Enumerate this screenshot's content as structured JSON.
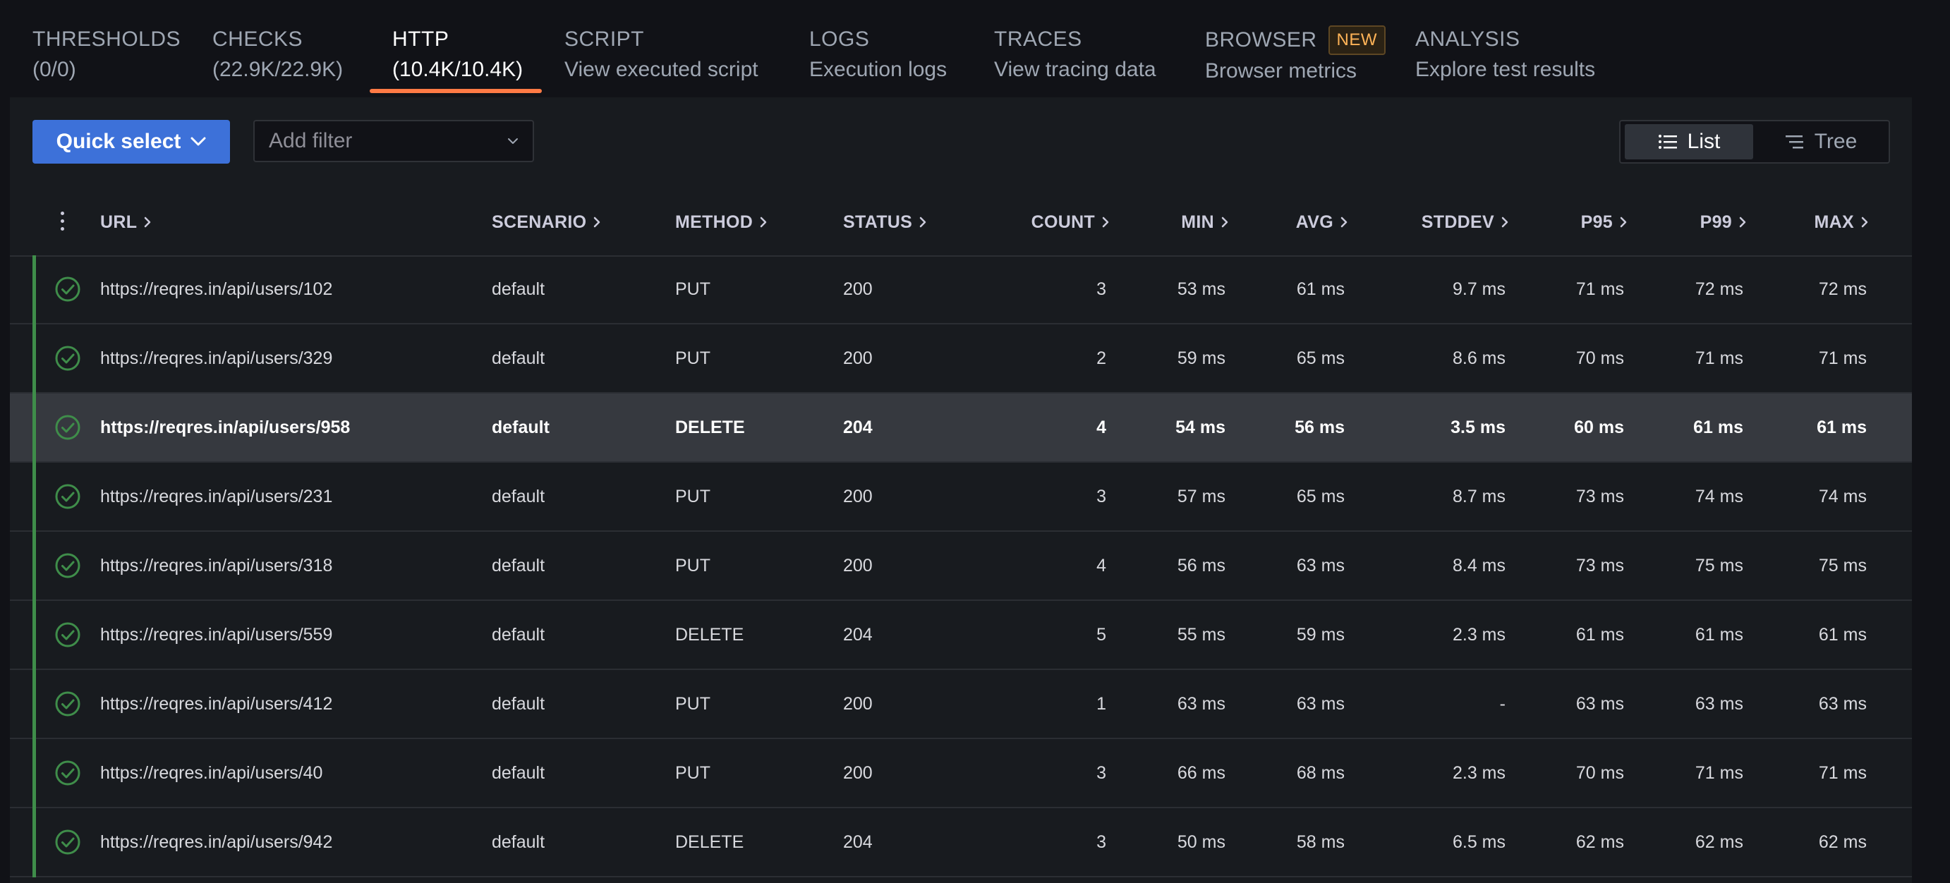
{
  "tabs": [
    {
      "title": "THRESHOLDS",
      "subtitle": "(0/0)"
    },
    {
      "title": "CHECKS",
      "subtitle": "(22.9K/22.9K)"
    },
    {
      "title": "HTTP",
      "subtitle": "(10.4K/10.4K)",
      "active": true
    },
    {
      "title": "SCRIPT",
      "subtitle": "View executed script"
    },
    {
      "title": "LOGS",
      "subtitle": "Execution logs"
    },
    {
      "title": "TRACES",
      "subtitle": "View tracing data"
    },
    {
      "title": "BROWSER",
      "subtitle": "Browser metrics",
      "badge": "NEW"
    },
    {
      "title": "ANALYSIS",
      "subtitle": "Explore test results"
    }
  ],
  "toolbar": {
    "quick_select_label": "Quick select",
    "filter_placeholder": "Add filter",
    "view_list_label": "List",
    "view_tree_label": "Tree"
  },
  "table": {
    "headers": [
      "URL",
      "SCENARIO",
      "METHOD",
      "STATUS",
      "COUNT",
      "MIN",
      "AVG",
      "STDDEV",
      "P95",
      "P99",
      "MAX"
    ],
    "rows": [
      {
        "url": "https://reqres.in/api/users/102",
        "scenario": "default",
        "method": "PUT",
        "status": "200",
        "count": "3",
        "min": "53 ms",
        "avg": "61 ms",
        "stddev": "9.7 ms",
        "p95": "71 ms",
        "p99": "72 ms",
        "max": "72 ms"
      },
      {
        "url": "https://reqres.in/api/users/329",
        "scenario": "default",
        "method": "PUT",
        "status": "200",
        "count": "2",
        "min": "59 ms",
        "avg": "65 ms",
        "stddev": "8.6 ms",
        "p95": "70 ms",
        "p99": "71 ms",
        "max": "71 ms"
      },
      {
        "url": "https://reqres.in/api/users/958",
        "scenario": "default",
        "method": "DELETE",
        "status": "204",
        "count": "4",
        "min": "54 ms",
        "avg": "56 ms",
        "stddev": "3.5 ms",
        "p95": "60 ms",
        "p99": "61 ms",
        "max": "61 ms",
        "highlighted": true
      },
      {
        "url": "https://reqres.in/api/users/231",
        "scenario": "default",
        "method": "PUT",
        "status": "200",
        "count": "3",
        "min": "57 ms",
        "avg": "65 ms",
        "stddev": "8.7 ms",
        "p95": "73 ms",
        "p99": "74 ms",
        "max": "74 ms"
      },
      {
        "url": "https://reqres.in/api/users/318",
        "scenario": "default",
        "method": "PUT",
        "status": "200",
        "count": "4",
        "min": "56 ms",
        "avg": "63 ms",
        "stddev": "8.4 ms",
        "p95": "73 ms",
        "p99": "75 ms",
        "max": "75 ms"
      },
      {
        "url": "https://reqres.in/api/users/559",
        "scenario": "default",
        "method": "DELETE",
        "status": "204",
        "count": "5",
        "min": "55 ms",
        "avg": "59 ms",
        "stddev": "2.3 ms",
        "p95": "61 ms",
        "p99": "61 ms",
        "max": "61 ms"
      },
      {
        "url": "https://reqres.in/api/users/412",
        "scenario": "default",
        "method": "PUT",
        "status": "200",
        "count": "1",
        "min": "63 ms",
        "avg": "63 ms",
        "stddev": "-",
        "p95": "63 ms",
        "p99": "63 ms",
        "max": "63 ms"
      },
      {
        "url": "https://reqres.in/api/users/40",
        "scenario": "default",
        "method": "PUT",
        "status": "200",
        "count": "3",
        "min": "66 ms",
        "avg": "68 ms",
        "stddev": "2.3 ms",
        "p95": "70 ms",
        "p99": "71 ms",
        "max": "71 ms"
      },
      {
        "url": "https://reqres.in/api/users/942",
        "scenario": "default",
        "method": "DELETE",
        "status": "204",
        "count": "3",
        "min": "50 ms",
        "avg": "58 ms",
        "stddev": "6.5 ms",
        "p95": "62 ms",
        "p99": "62 ms",
        "max": "62 ms"
      }
    ]
  },
  "colors": {
    "accent_tab": "#ff7a45",
    "primary_button": "#3d71d9",
    "status_ok": "#3f8d4a",
    "badge_new": "#ffb357"
  },
  "icons": {
    "quick_select": "chevron-down-icon",
    "filter": "chevron-down-icon",
    "list": "list-icon",
    "tree": "tree-icon",
    "row_status": "check-circle-icon",
    "sort": "chevron-right-icon",
    "column_menu": "kebab-menu-icon"
  }
}
